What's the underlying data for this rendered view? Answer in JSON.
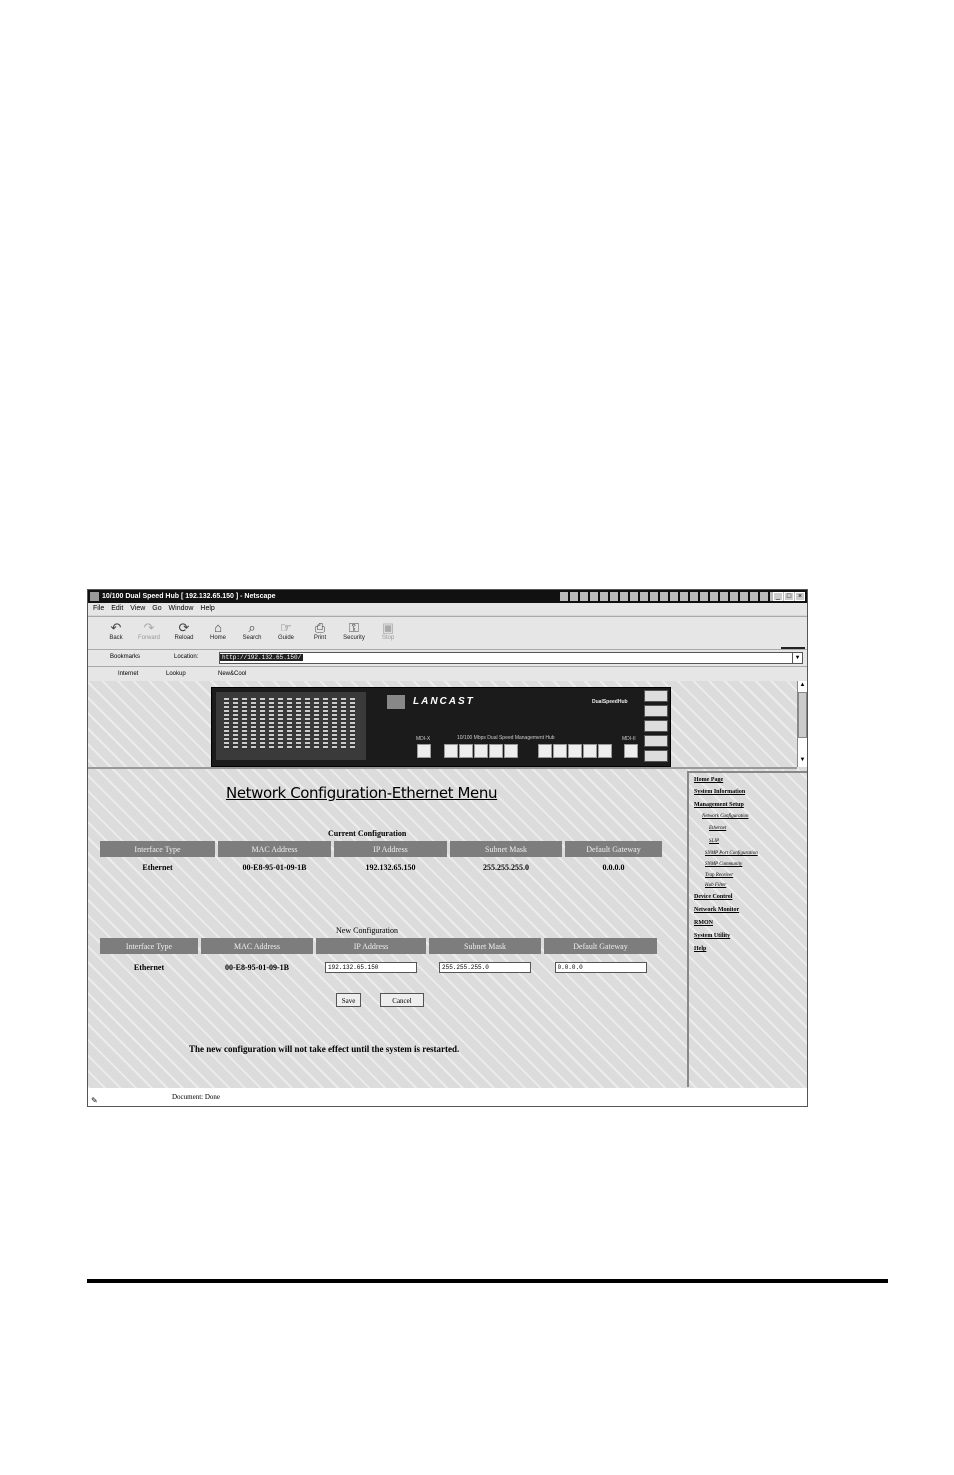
{
  "window": {
    "title": "10/100 Dual Speed Hub [ 192.132.65.150 ] - Netscape"
  },
  "menubar": {
    "items": [
      "File",
      "Edit",
      "View",
      "Go",
      "Window",
      "Help"
    ]
  },
  "toolbar": {
    "buttons": [
      {
        "label": "Back",
        "icon": "back-icon",
        "glyph": "↶"
      },
      {
        "label": "Forward",
        "icon": "forward-icon",
        "glyph": "↷",
        "disabled": true
      },
      {
        "label": "Reload",
        "icon": "reload-icon",
        "glyph": "⟳"
      },
      {
        "label": "Home",
        "icon": "home-icon",
        "glyph": "⌂"
      },
      {
        "label": "Search",
        "icon": "search-icon",
        "glyph": "⌕"
      },
      {
        "label": "Guide",
        "icon": "guide-icon",
        "glyph": "☞"
      },
      {
        "label": "Print",
        "icon": "print-icon",
        "glyph": "⎙"
      },
      {
        "label": "Security",
        "icon": "security-icon",
        "glyph": "⚿"
      },
      {
        "label": "Stop",
        "icon": "stop-icon",
        "glyph": "▣",
        "disabled": true
      }
    ]
  },
  "locationbar": {
    "bookmarks": "Bookmarks",
    "location_label": "Location:",
    "url": "http://192.132.65.150/"
  },
  "directorybar": {
    "items": [
      "Internet",
      "Lookup",
      "New&Cool"
    ]
  },
  "banner": {
    "brand": "LANCAST",
    "model": "DualSpeedHub",
    "strip": "10/100 Mbps Dual Speed Management Hub",
    "port_labels": [
      "MDI-X",
      "MDI-II"
    ]
  },
  "page": {
    "title": "Network Configuration-Ethernet Menu",
    "current_caption": "Current Configuration",
    "new_caption": "New Configuration",
    "headers": [
      "Interface Type",
      "MAC Address",
      "IP Address",
      "Subnet Mask",
      "Default Gateway"
    ],
    "current_row": [
      "Ethernet",
      "00-E8-95-01-09-1B",
      "192.132.65.150",
      "255.255.255.0",
      "0.0.0.0"
    ],
    "new_row": {
      "type": "Ethernet",
      "mac": "00-E8-95-01-09-1B",
      "ip": "192.132.65.150",
      "mask": "255.255.255.0",
      "gateway": "0.0.0.0"
    },
    "save_label": "Save",
    "cancel_label": "Cancel",
    "note": "The new configuration will not take effect until the system is restarted."
  },
  "sidebar": {
    "items": [
      "Home Page",
      "System Information",
      "Management Setup",
      "Device Control",
      "Network Monitor",
      "RMON",
      "System Utility",
      "Help"
    ],
    "subitems": [
      "Network Configuration",
      "Ethernet",
      "SLIP",
      "SNMP Port Configuration",
      "SNMP Community",
      "Trap Receiver",
      "Hub Filter"
    ]
  },
  "status": {
    "text": "Document: Done"
  }
}
